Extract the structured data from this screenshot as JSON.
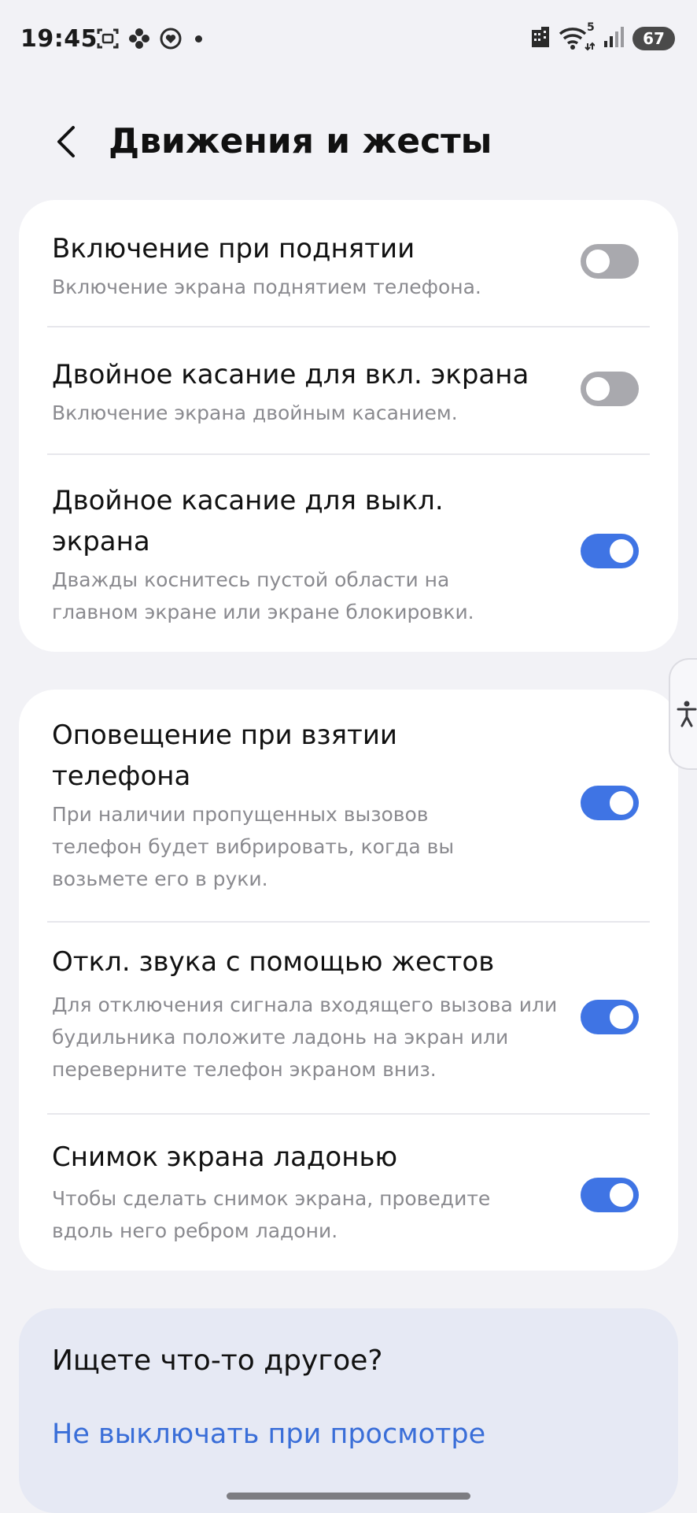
{
  "status_bar": {
    "time": "19:45",
    "battery": "67",
    "left_icons": [
      "screen-capture-icon",
      "flower-icon",
      "heart-badge-icon",
      "dot-icon"
    ],
    "right_icons": [
      "building-icon",
      "wifi-icon",
      "signal-icon",
      "battery-icon"
    ],
    "wifi_badge": "5"
  },
  "header": {
    "title": "Движения и жесты"
  },
  "group1": {
    "items": [
      {
        "title": "Включение при поднятии",
        "desc": "Включение экрана поднятием телефона.",
        "enabled": false
      },
      {
        "title": "Двойное касание для вкл. экрана",
        "desc": "Включение экрана двойным касанием.",
        "enabled": false
      },
      {
        "title": "Двойное касание для выкл. экрана",
        "desc": "Дважды коснитесь пустой области на главном экране или экране блокировки.",
        "enabled": true
      }
    ]
  },
  "group2": {
    "items": [
      {
        "title": "Оповещение при взятии телефона",
        "desc": "При наличии пропущенных вызовов телефон будет вибрировать, когда вы возьмете его в руки.",
        "enabled": true
      },
      {
        "title": "Откл. звука с помощью жестов",
        "desc": "Для отключения сигнала входящего вызова или будильника положите ладонь на экран или переверните телефон экраном вниз.",
        "enabled": true
      },
      {
        "title": "Снимок экрана ладонью",
        "desc": "Чтобы сделать снимок экрана, проведите вдоль него ребром ладони.",
        "enabled": true
      }
    ]
  },
  "suggestions": {
    "title": "Ищете что-то другое?",
    "link": "Не выключать при просмотре"
  },
  "colors": {
    "accent": "#3f74e4",
    "switch_off": "#a9a9ae",
    "background": "#f2f2f6",
    "card": "#ffffff",
    "link": "#3a6ed8"
  }
}
